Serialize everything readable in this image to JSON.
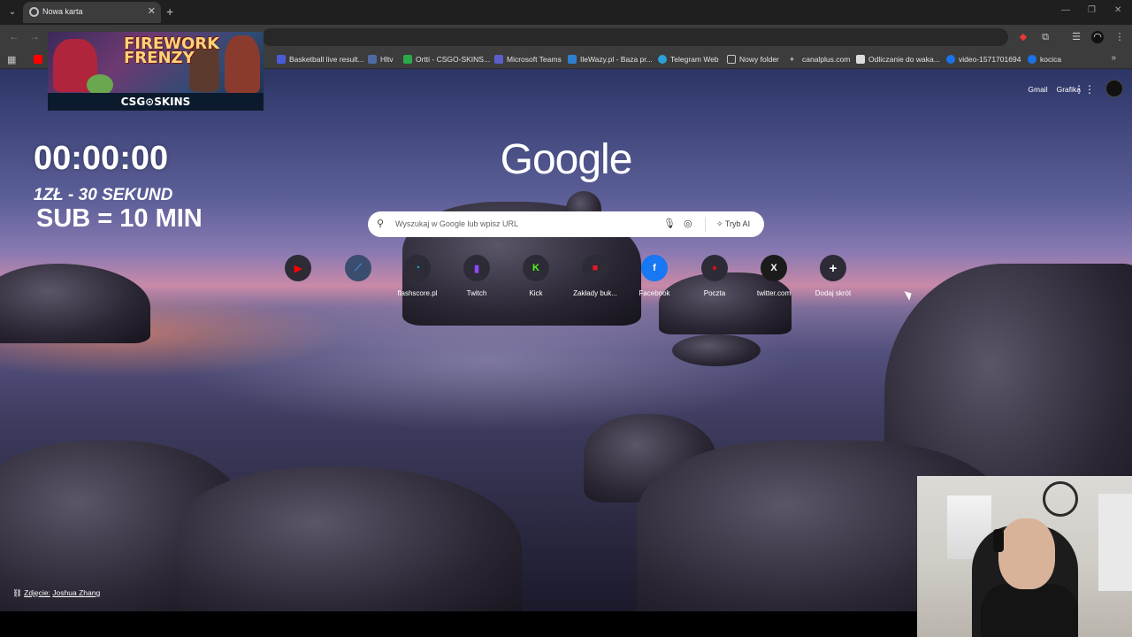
{
  "tab": {
    "title": "Nowa karta",
    "close": "✕",
    "new": "+"
  },
  "bookmarks": [
    {
      "label": "",
      "color": "#ff0000"
    },
    {
      "label": "Basketball live result...",
      "color": "#4b5bd6"
    },
    {
      "label": "Hltv",
      "color": "#4e6aa3"
    },
    {
      "label": "Ortti - CSGO-SKINS...",
      "color": "#2aa84a"
    },
    {
      "label": "Microsoft Teams",
      "color": "#5b5fc7"
    },
    {
      "label": "IleWazy.pl - Baza pr...",
      "color": "#2f7fd0"
    },
    {
      "label": "Telegram Web",
      "color": "#2aa1da"
    },
    {
      "label": "Nowy folder",
      "color": "folder"
    },
    {
      "label": "canalplus.com",
      "color": "#ffffff"
    },
    {
      "label": "Odliczanie do waka...",
      "color": "#dddddd"
    },
    {
      "label": "video-1571701694",
      "color": "#1a73e8"
    },
    {
      "label": "kocica",
      "color": "#1a73e8"
    }
  ],
  "header": {
    "gmail": "Gmail",
    "images": "Grafika"
  },
  "logo": "Google",
  "search": {
    "placeholder": "Wyszukaj w Google lub wpisz URL",
    "ai_mode": "Tryb AI"
  },
  "shortcuts": [
    {
      "label": "",
      "glyph": "▶",
      "color": "#ff0000"
    },
    {
      "label": "",
      "glyph": "⟋",
      "color": "#4a8fd6"
    },
    {
      "label": "flashscore.pl",
      "glyph": "◔",
      "color": "#1fb1c9"
    },
    {
      "label": "Twitch",
      "glyph": "▮",
      "color": "#9146ff"
    },
    {
      "label": "Kick",
      "glyph": "K",
      "color": "#53fc18"
    },
    {
      "label": "Zakłady buk...",
      "glyph": "■",
      "color": "#e21b24"
    },
    {
      "label": "Facebook",
      "glyph": "f",
      "color": "#1877f2"
    },
    {
      "label": "Poczta",
      "glyph": "●",
      "color": "#c5161d"
    },
    {
      "label": "twitter.com",
      "glyph": "X",
      "color": "#ffffff"
    },
    {
      "label": "Dodaj skrót",
      "glyph": "+",
      "color": "#ffffff"
    }
  ],
  "credit": {
    "prefix": "Zdjęcie:",
    "author": "Joshua Zhang"
  },
  "overlay": {
    "banner_title": "FIREWORK FRENZY",
    "banner_brand": "CSG⊙SKINS",
    "timer": "00:00:00",
    "rate": "1ZŁ - 30 SEKUND",
    "sub": "SUB = 10 MIN"
  }
}
